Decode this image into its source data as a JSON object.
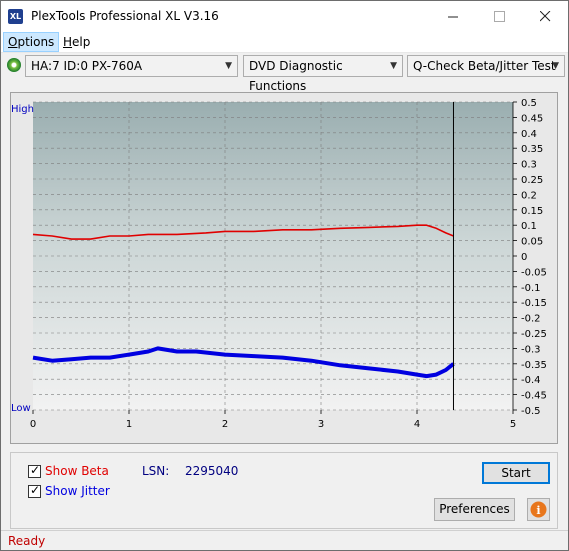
{
  "window": {
    "title": "PlexTools Professional XL V3.16",
    "icon_text": "XL"
  },
  "menu": [
    {
      "label": "Options",
      "key": "O"
    },
    {
      "label": "Help",
      "key": "H"
    }
  ],
  "toolbar": {
    "drive": "HA:7 ID:0  PX-760A",
    "function": "DVD Diagnostic Functions",
    "test": "Q-Check Beta/Jitter Test"
  },
  "chart_data": {
    "type": "line",
    "left_axis_labels": {
      "top": "High",
      "bottom": "Low"
    },
    "x_ticks": [
      "0",
      "1",
      "2",
      "3",
      "4",
      "5"
    ],
    "xlim": [
      0,
      5
    ],
    "y_ticks": [
      "0.5",
      "0.45",
      "0.4",
      "0.35",
      "0.3",
      "0.25",
      "0.2",
      "0.15",
      "0.1",
      "0.05",
      "0",
      "-0.05",
      "-0.1",
      "-0.15",
      "-0.2",
      "-0.25",
      "-0.3",
      "-0.35",
      "-0.4",
      "-0.45",
      "-0.5"
    ],
    "ylim": [
      -0.5,
      0.5
    ],
    "end_marker_x": 4.38,
    "grid": true,
    "series": [
      {
        "name": "Beta",
        "color": "#e00000",
        "points": [
          [
            0,
            0.07
          ],
          [
            0.2,
            0.065
          ],
          [
            0.4,
            0.055
          ],
          [
            0.6,
            0.055
          ],
          [
            0.8,
            0.065
          ],
          [
            1.0,
            0.065
          ],
          [
            1.2,
            0.07
          ],
          [
            1.5,
            0.07
          ],
          [
            1.8,
            0.075
          ],
          [
            2.0,
            0.08
          ],
          [
            2.3,
            0.08
          ],
          [
            2.6,
            0.085
          ],
          [
            2.9,
            0.085
          ],
          [
            3.2,
            0.09
          ],
          [
            3.5,
            0.093
          ],
          [
            3.8,
            0.096
          ],
          [
            4.0,
            0.1
          ],
          [
            4.1,
            0.1
          ],
          [
            4.2,
            0.09
          ],
          [
            4.3,
            0.075
          ],
          [
            4.38,
            0.065
          ]
        ]
      },
      {
        "name": "Jitter",
        "color": "#0000e0",
        "points": [
          [
            0,
            -0.33
          ],
          [
            0.2,
            -0.34
          ],
          [
            0.4,
            -0.335
          ],
          [
            0.6,
            -0.33
          ],
          [
            0.8,
            -0.33
          ],
          [
            1.0,
            -0.32
          ],
          [
            1.2,
            -0.31
          ],
          [
            1.3,
            -0.3
          ],
          [
            1.5,
            -0.31
          ],
          [
            1.7,
            -0.31
          ],
          [
            2.0,
            -0.32
          ],
          [
            2.3,
            -0.325
          ],
          [
            2.6,
            -0.33
          ],
          [
            2.9,
            -0.34
          ],
          [
            3.2,
            -0.355
          ],
          [
            3.5,
            -0.365
          ],
          [
            3.8,
            -0.375
          ],
          [
            4.0,
            -0.385
          ],
          [
            4.1,
            -0.39
          ],
          [
            4.2,
            -0.385
          ],
          [
            4.3,
            -0.37
          ],
          [
            4.38,
            -0.35
          ]
        ]
      }
    ]
  },
  "controls": {
    "show_beta": "Show Beta",
    "show_jitter": "Show Jitter",
    "lsn_label": "LSN:",
    "lsn_value": "2295040",
    "start": "Start",
    "preferences": "Preferences",
    "show_beta_checked": true,
    "show_jitter_checked": true
  },
  "status": {
    "text": "Ready"
  }
}
